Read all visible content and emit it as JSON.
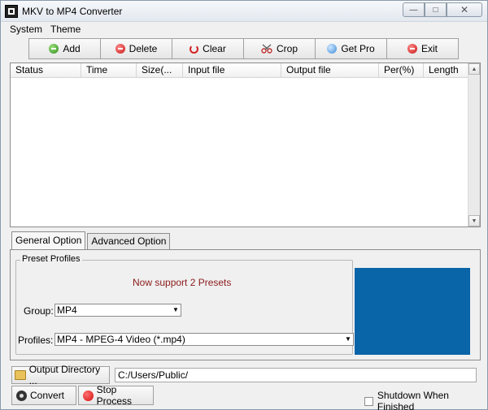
{
  "window": {
    "title": "MKV to MP4 Converter"
  },
  "menu": {
    "items": [
      "System",
      "Theme"
    ]
  },
  "toolbar": {
    "buttons": [
      {
        "label": "Add",
        "icon": "add-icon"
      },
      {
        "label": "Delete",
        "icon": "delete-icon"
      },
      {
        "label": "Clear",
        "icon": "clear-icon"
      },
      {
        "label": "Crop",
        "icon": "crop-icon"
      },
      {
        "label": "Get Pro",
        "icon": "globe-icon"
      },
      {
        "label": "Exit",
        "icon": "exit-icon"
      }
    ]
  },
  "file_list": {
    "columns": [
      "Status",
      "Time",
      "Size(...",
      "Input file",
      "Output file",
      "Per(%)",
      "Length"
    ],
    "rows": []
  },
  "tabs": [
    "General Option",
    "Advanced Option"
  ],
  "presets": {
    "legend": "Preset Profiles",
    "support_text": "Now support 2 Presets",
    "group_label": "Group:",
    "group_value": "MP4",
    "profiles_label": "Profiles:",
    "profiles_value": "MP4 - MPEG-4 Video (*.mp4)"
  },
  "output": {
    "button_label": "Output Directory ...",
    "path": "C:/Users/Public/"
  },
  "actions": {
    "convert_label": "Convert",
    "stop_label": "Stop Process",
    "shutdown_label": "Shutdown When Finished",
    "shutdown_checked": false
  },
  "colors": {
    "preview": "#0a64a8",
    "support_text": "#8b1a1a"
  }
}
